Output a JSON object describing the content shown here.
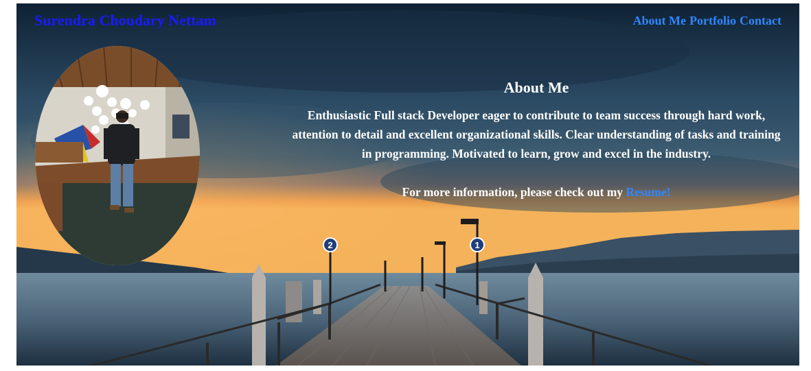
{
  "header": {
    "site_title": "Surendra Choudary Nettam",
    "nav": [
      {
        "label": "About Me"
      },
      {
        "label": "Portfolio"
      },
      {
        "label": "Contact"
      }
    ]
  },
  "about": {
    "heading": "About Me",
    "bio": "Enthusiastic Full stack Developer eager to contribute to team success through hard work, attention to detail and excellent organizational skills. Clear understanding of tasks and training in programming. Motivated to learn, grow and excel in the industry.",
    "more_prefix": "For more information, please check out my",
    "resume_link": "Resume!"
  },
  "pier_signs": [
    "2",
    "1"
  ],
  "colors": {
    "title": "#1a1aff",
    "nav_link": "#2f86ff",
    "resume_link": "#2f86ff",
    "text": "#ffffff"
  },
  "icons": {
    "hero_background": "lake-pier-sunset-image",
    "profile_photo": "person-portrait-photo"
  }
}
